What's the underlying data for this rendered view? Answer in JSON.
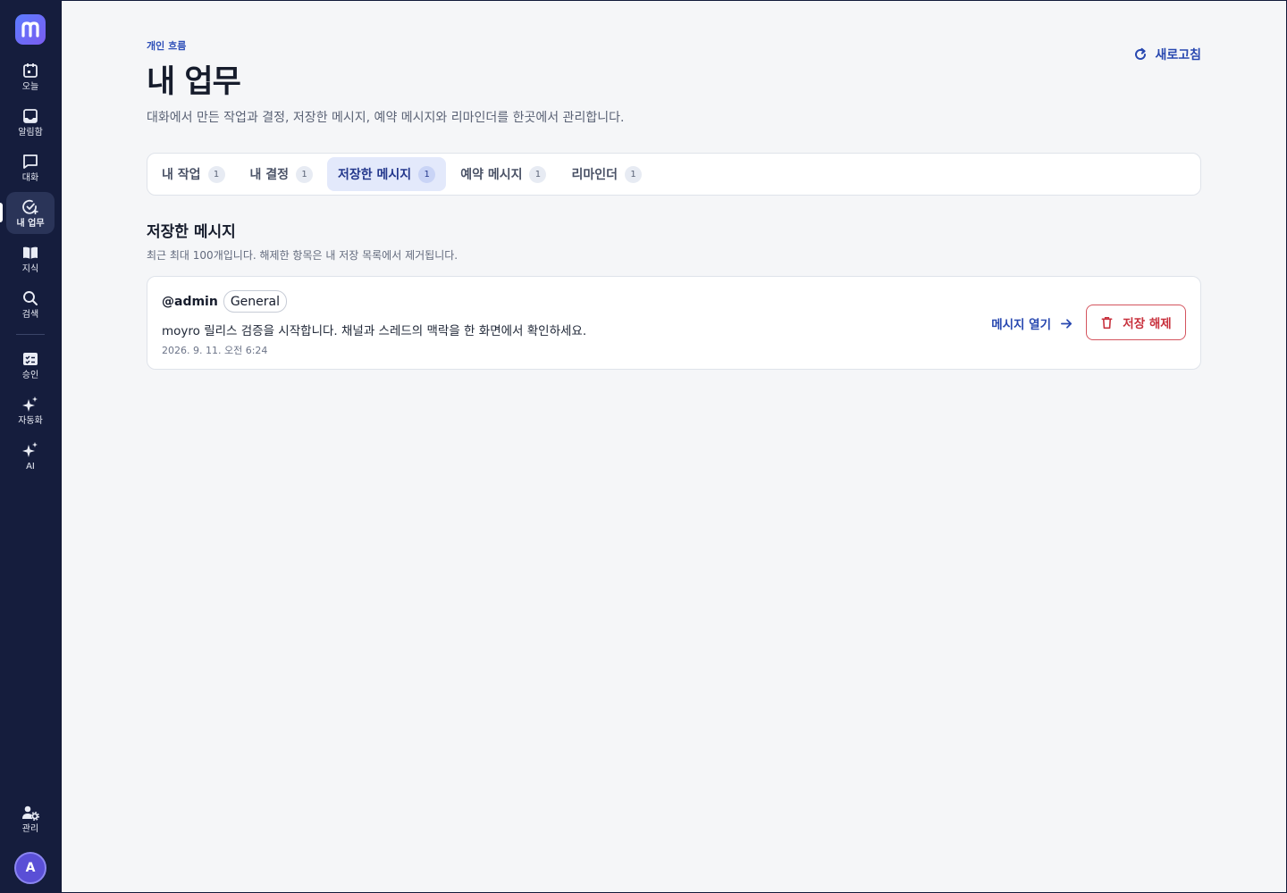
{
  "brand": {
    "logo_letter": "m",
    "accent": "#5b7cff"
  },
  "sidebar": {
    "items": [
      {
        "label": "오늘",
        "icon": "calendar-icon"
      },
      {
        "label": "알림함",
        "icon": "inbox-icon"
      },
      {
        "label": "대화",
        "icon": "chat-icon"
      },
      {
        "label": "내 업무",
        "icon": "task-check-icon",
        "active": true
      },
      {
        "label": "지식",
        "icon": "book-icon"
      },
      {
        "label": "검색",
        "icon": "search-icon"
      },
      {
        "label": "승인",
        "icon": "approval-icon"
      },
      {
        "label": "자동화",
        "icon": "sparkle-icon"
      },
      {
        "label": "AI",
        "icon": "sparkle-icon"
      }
    ],
    "admin_label": "관리",
    "avatar_initial": "A"
  },
  "header": {
    "eyebrow": "개인 흐름",
    "title": "내 업무",
    "description": "대화에서 만든 작업과 결정, 저장한 메시지, 예약 메시지와 리마인더를 한곳에서 관리합니다.",
    "refresh_label": "새로고침"
  },
  "tabs": [
    {
      "label": "내 작업",
      "count": "1"
    },
    {
      "label": "내 결정",
      "count": "1"
    },
    {
      "label": "저장한 메시지",
      "count": "1",
      "active": true
    },
    {
      "label": "예약 메시지",
      "count": "1"
    },
    {
      "label": "리마인더",
      "count": "1"
    }
  ],
  "section": {
    "title": "저장한 메시지",
    "description": "최근 최대 100개입니다. 해제한 항목은 내 저장 목록에서 제거됩니다."
  },
  "saved_messages": [
    {
      "author": "@admin",
      "channel": "General",
      "text": "moyro 릴리스 검증을 시작합니다. 채널과 스레드의 맥락을 한 화면에서 확인하세요.",
      "timestamp": "2026. 9. 11. 오전 6:24",
      "open_label": "메시지 열기",
      "unsave_label": "저장 해제"
    }
  ],
  "colors": {
    "sidebar_bg": "#151d3d",
    "link": "#2848b0",
    "danger": "#c8323e",
    "active_tab_bg": "#e3e9fb"
  }
}
